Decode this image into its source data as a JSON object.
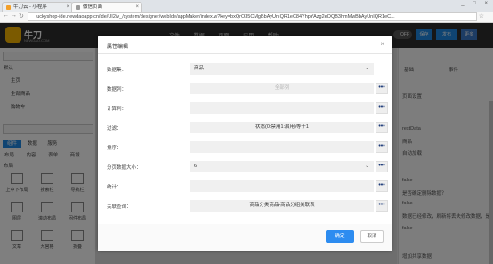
{
  "browser": {
    "tabs": [
      {
        "label": "牛刀云 - 小程序"
      },
      {
        "label": "微信页面"
      }
    ],
    "url": "luckyshop-ide.newdaoapp.cn/ide/UI2/v_/system/designer/webIde/appMaker/index.w?key=bxQrO35CMgBbAyUnIQR1eC84YhpYAzg2eOQB3hmMwBbAyUnIQR1eC..."
  },
  "app": {
    "logo_text": "牛刀",
    "logo_sub": "NEWDAO.COM",
    "nav": [
      "文件",
      "数据",
      "页面",
      "应用",
      "帮助"
    ],
    "toggle": "OFF",
    "btn_save": "保存",
    "btn_publish": "发布",
    "btn_more": "更多"
  },
  "left_panel": {
    "items": [
      "默认",
      "主页",
      "全部商品",
      "购物车"
    ],
    "tabs": [
      "组件",
      "数据",
      "服务"
    ],
    "sub_tabs": [
      "布局",
      "内容",
      "表单",
      "商城"
    ],
    "section": "布局",
    "grid": [
      "上中下布局",
      "搜索栏",
      "导航栏",
      "图层",
      "滚动布局",
      "固件布局",
      "文章",
      "九宫格",
      "折叠"
    ]
  },
  "right_panel": {
    "tabs": [
      "基础",
      "事件"
    ],
    "btn": "页面设置",
    "rows": [
      "restData",
      "商品",
      "自动加载",
      "false",
      "是否确定删除数据？",
      "false",
      "数据已经修改，刷新将丢失修改数据，是否刷新？",
      "false",
      "增加共享数据"
    ]
  },
  "modal": {
    "title": "属性编辑",
    "close": "×",
    "fields": [
      {
        "label": "数据集：",
        "value": "商品",
        "placeholder": "",
        "type": "select"
      },
      {
        "label": "数据列：",
        "value": "",
        "placeholder": "全部列",
        "type": "more"
      },
      {
        "label": "计算列：",
        "value": "",
        "placeholder": "",
        "type": "more"
      },
      {
        "label": "过滤：",
        "value": "状态(0:禁用1:启用)等于1",
        "placeholder": "",
        "type": "more"
      },
      {
        "label": "排序：",
        "value": "",
        "placeholder": "",
        "type": "more"
      },
      {
        "label": "分页数据大小：",
        "value": "6",
        "placeholder": "",
        "type": "select-more"
      },
      {
        "label": "统计：",
        "value": "",
        "placeholder": "",
        "type": "more"
      },
      {
        "label": "关联查询：",
        "value": "商品分类商品-商品分组关联表",
        "placeholder": "",
        "type": "more"
      }
    ],
    "more_label": "•••",
    "ok": "确定",
    "cancel": "取消"
  }
}
